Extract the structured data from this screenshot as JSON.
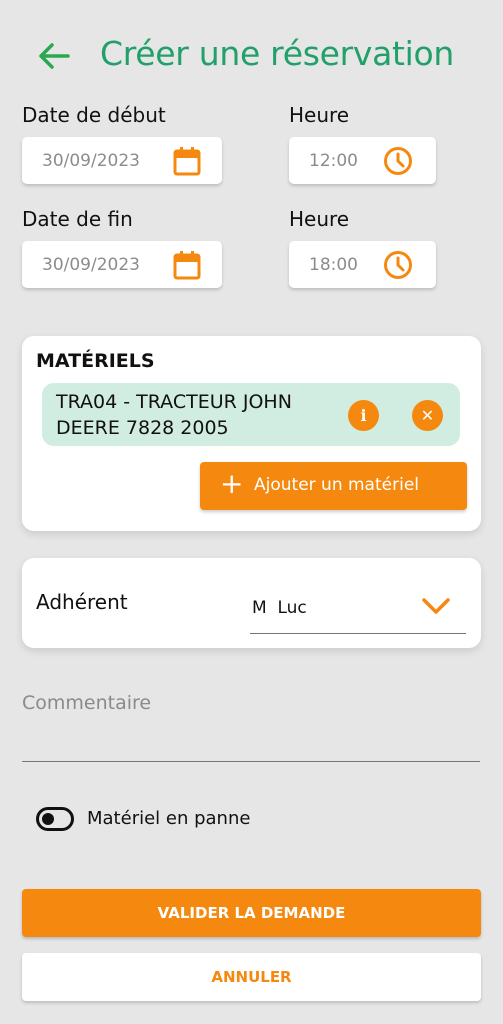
{
  "header": {
    "title": "Créer une réservation",
    "back_icon": "arrow-left-icon"
  },
  "start": {
    "date_label": "Date de début",
    "date_value": "30/09/2023",
    "time_label": "Heure",
    "time_value": "12:00"
  },
  "end": {
    "date_label": "Date de fin",
    "date_value": "30/09/2023",
    "time_label": "Heure",
    "time_value": "18:00"
  },
  "materiels": {
    "title": "MATÉRIELS",
    "items": [
      {
        "label": "TRA04 - TRACTEUR JOHN DEERE 7828 2005"
      }
    ],
    "add_label": "Ajouter un matériel"
  },
  "adherent": {
    "label": "Adhérent",
    "value": "M  Luc"
  },
  "comment": {
    "placeholder": "Commentaire",
    "value": ""
  },
  "toggle": {
    "label": "Matériel en panne",
    "checked": false
  },
  "actions": {
    "submit_label": "VALIDER LA DEMANDE",
    "cancel_label": "ANNULER"
  },
  "colors": {
    "accent": "#f5890f",
    "brand_green": "#21a06a",
    "chip_bg": "#d1ece0",
    "background": "#e6e6e6"
  },
  "icons": {
    "calendar": "calendar-icon",
    "clock": "clock-icon",
    "info": "info-icon",
    "remove": "close-circle-icon",
    "add": "plus-icon",
    "dropdown": "chevron-down-icon"
  }
}
